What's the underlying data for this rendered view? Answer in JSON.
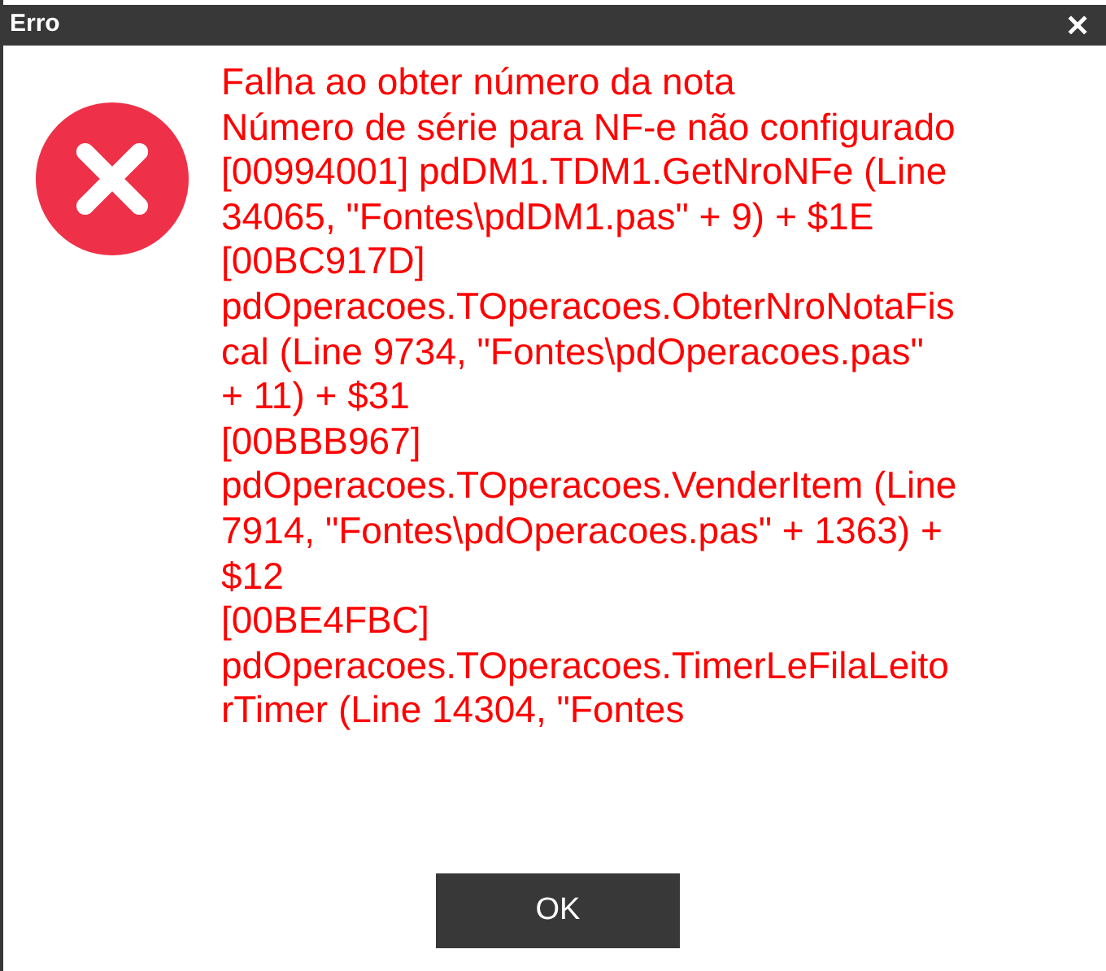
{
  "window": {
    "title": "Erro",
    "close": "✕"
  },
  "message_lines": [
    "Falha ao obter número da nota",
    "Número de série para NF-e não configurado",
    "[00994001] pdDM1.TDM1.GetNroNFe (Line",
    "34065, \"Fontes\\pdDM1.pas\" + 9) + $1E",
    "[00BC917D]",
    "pdOperacoes.TOperacoes.ObterNroNotaFis",
    "cal (Line 9734, \"Fontes\\pdOperacoes.pas\"",
    "+ 11) + $31",
    "[00BBB967]",
    "pdOperacoes.TOperacoes.VenderItem (Line",
    "7914, \"Fontes\\pdOperacoes.pas\" + 1363) +",
    "$12",
    "[00BE4FBC]",
    "pdOperacoes.TOperacoes.TimerLeFilaLeito",
    "rTimer (Line 14304, \"Fontes"
  ],
  "buttons": [
    "OK"
  ]
}
